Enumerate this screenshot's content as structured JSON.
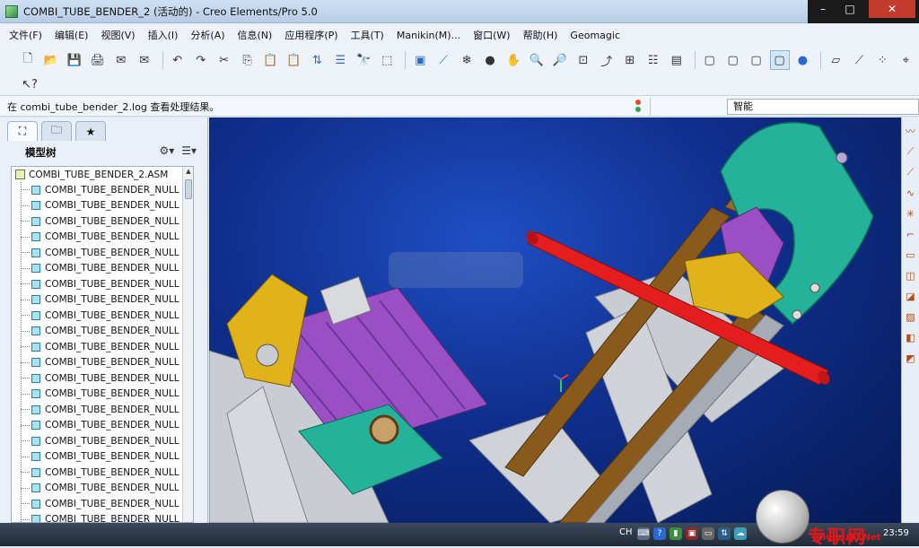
{
  "window": {
    "title": "COMBI_TUBE_BENDER_2 (活动的) - Creo Elements/Pro 5.0"
  },
  "menu": {
    "items": [
      "文件(F)",
      "编辑(E)",
      "视图(V)",
      "插入(I)",
      "分析(A)",
      "信息(N)",
      "应用程序(P)",
      "工具(T)",
      "Manikin(M)...",
      "窗口(W)",
      "帮助(H)",
      "Geomagic"
    ]
  },
  "message": {
    "text": "在 combi_tube_bender_2.log 查看处理结果。"
  },
  "filter": {
    "value": "智能"
  },
  "model_tree": {
    "title": "模型树",
    "root": "COMBI_TUBE_BENDER_2.ASM",
    "items": [
      "COMBI_TUBE_BENDER_NULL",
      "COMBI_TUBE_BENDER_NULL",
      "COMBI_TUBE_BENDER_NULL",
      "COMBI_TUBE_BENDER_NULL",
      "COMBI_TUBE_BENDER_NULL",
      "COMBI_TUBE_BENDER_NULL",
      "COMBI_TUBE_BENDER_NULL",
      "COMBI_TUBE_BENDER_NULL",
      "COMBI_TUBE_BENDER_NULL",
      "COMBI_TUBE_BENDER_NULL",
      "COMBI_TUBE_BENDER_NULL",
      "COMBI_TUBE_BENDER_NULL",
      "COMBI_TUBE_BENDER_NULL",
      "COMBI_TUBE_BENDER_NULL",
      "COMBI_TUBE_BENDER_NULL",
      "COMBI_TUBE_BENDER_NULL",
      "COMBI_TUBE_BENDER_NULL",
      "COMBI_TUBE_BENDER_NULL",
      "COMBI_TUBE_BENDER_NULL",
      "COMBI_TUBE_BENDER_NULL",
      "COMBI_TUBE_BENDER_NULL",
      "COMBI_TUBE_BENDER_NULL"
    ]
  },
  "taskbar": {
    "lang": "CH",
    "clock": "23:59"
  },
  "watermark": {
    "main": "专职网",
    "sub": "Zhuanzhi.Net"
  },
  "colors": {
    "viewport_bg": "#0f2f8d",
    "tube_red": "#e41e1e",
    "teal": "#24b39a",
    "purple": "#9b4fc4",
    "yellow": "#e0b31a",
    "brown": "#8a5a1c",
    "gray": "#c9ccd2"
  }
}
